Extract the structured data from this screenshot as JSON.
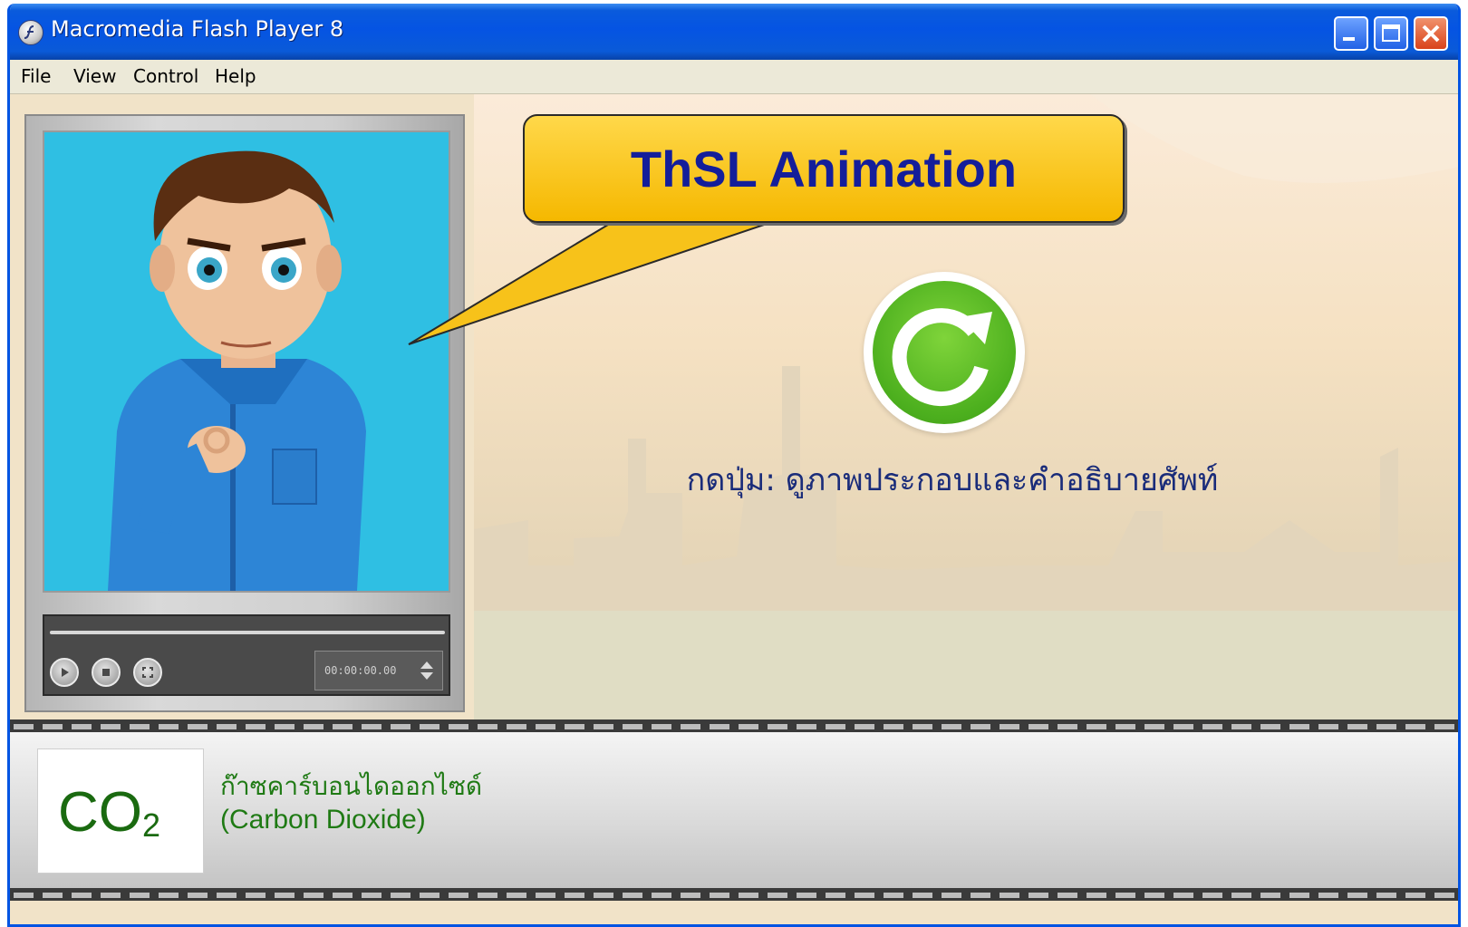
{
  "window": {
    "title": "Macromedia Flash Player 8",
    "controls": [
      "minimize-icon",
      "maximize-icon",
      "close-icon"
    ]
  },
  "menubar": {
    "items": [
      {
        "label": "File"
      },
      {
        "label": "View"
      },
      {
        "label": "Control"
      },
      {
        "label": "Help"
      }
    ]
  },
  "video_player": {
    "time": "00:00:00.00",
    "progress": 0,
    "buttons": [
      "play-icon",
      "stop-icon",
      "fullscreen-icon"
    ]
  },
  "stage": {
    "callout": "ThSL Animation",
    "replay_icon": "replay-icon",
    "instruction": "กดปุ่ม: ดูภาพประกอบและคำอธิบายศัพท์"
  },
  "term": {
    "symbol_main": "CO",
    "symbol_sub": "2",
    "thai": "ก๊าซคาร์บอนไดออกไซด์",
    "english": "(Carbon Dioxide)"
  },
  "colors": {
    "titlebar": "#0554e3",
    "callout": "#f5b800",
    "callout_text": "#141e9a",
    "replay": "#4caf1e",
    "term_text": "#1f7a14",
    "video_bg": "#2fbfe3"
  }
}
